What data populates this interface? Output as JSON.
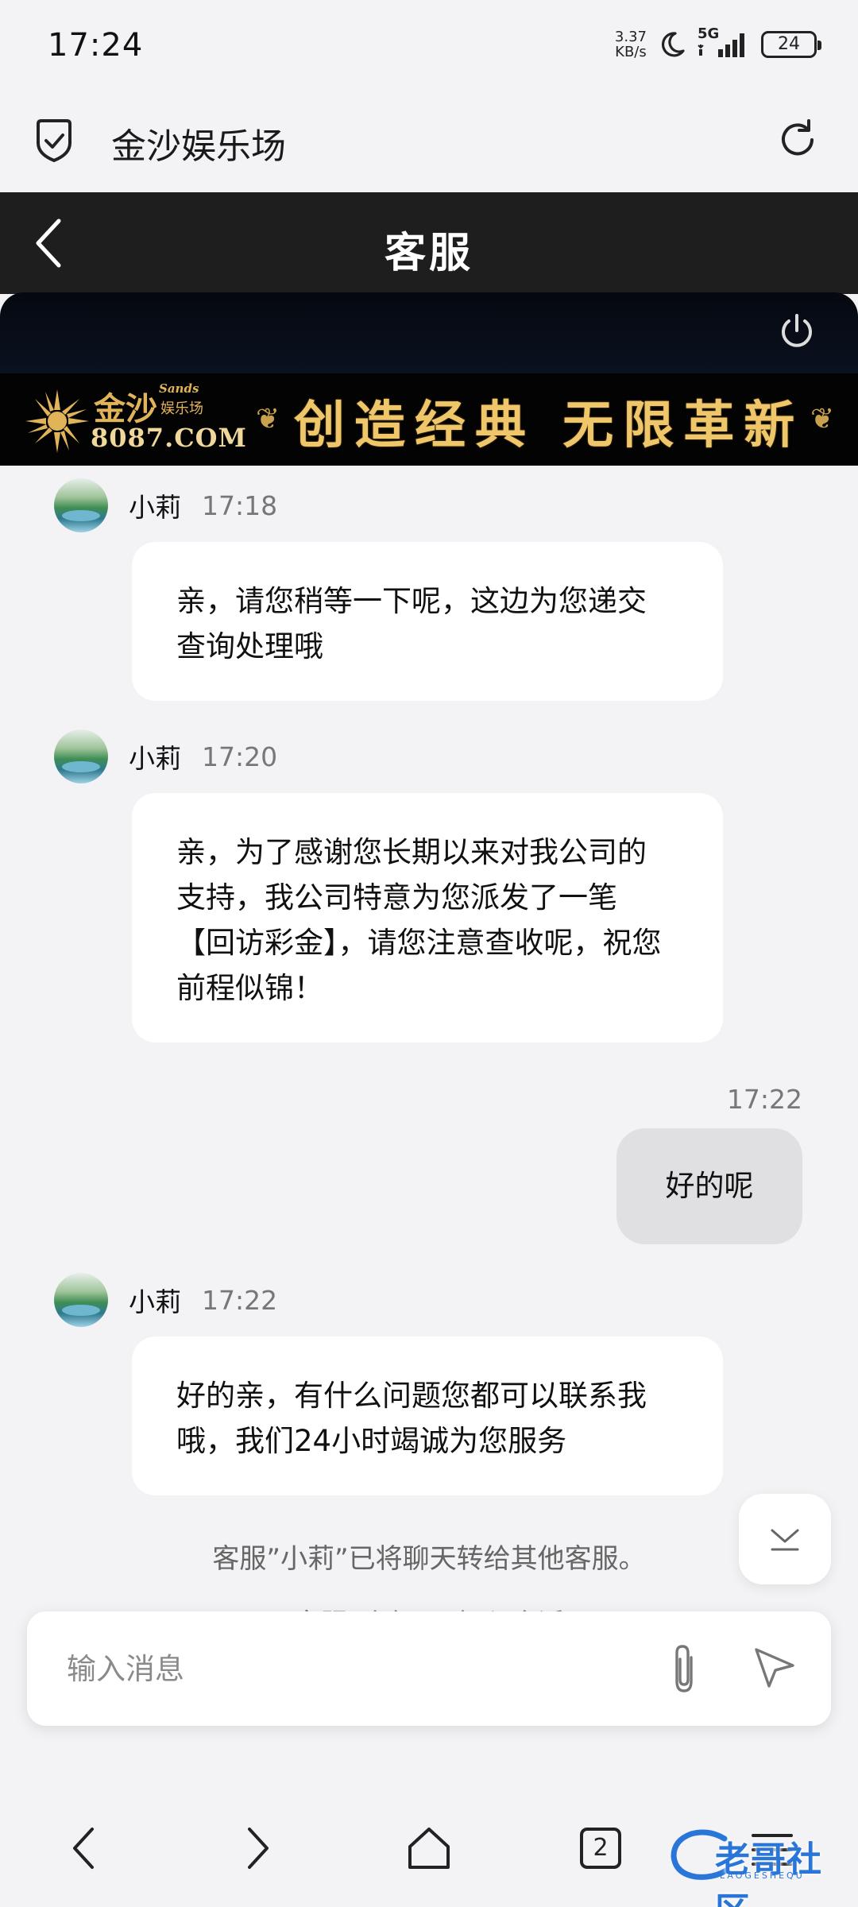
{
  "status_bar": {
    "time": "17:24",
    "net_speed_value": "3.37",
    "net_speed_unit": "KB/s",
    "network": "5G",
    "battery": "24"
  },
  "browser": {
    "site_title": "金沙娱乐场"
  },
  "chat_header": {
    "title": "客服"
  },
  "banner": {
    "brand": "金沙",
    "brand_sands": "Sands",
    "brand_sub": "娱乐场",
    "url": "8087.COM",
    "slogan": "创造经典 无限革新"
  },
  "messages": [
    {
      "sender": "小莉",
      "time": "17:18",
      "text_lines": [
        "亲，请您稍等一下呢，这边为您递交",
        "查询处理哦"
      ]
    },
    {
      "sender": "小莉",
      "time": "17:20",
      "text_lines": [
        "亲，为了感谢您长期以来对我公司的",
        "支持，我公司特意为您派发了一笔",
        "【回访彩金】，请您注意查收呢，祝您",
        "前程似锦！"
      ]
    },
    {
      "me": true,
      "time": "17:22",
      "text": "好的呢"
    },
    {
      "sender": "小莉",
      "time": "17:22",
      "text_lines": [
        "好的亲，有什么问题您都可以联系我",
        "哦，我们24小时竭诚为您服务"
      ]
    }
  ],
  "system_note": "客服”小莉”已将聊天转给其他客服。",
  "system_note_partial": "客服”小红”已加入会话",
  "input": {
    "placeholder": "输入消息"
  },
  "nav": {
    "tab_count": "2"
  },
  "watermark": {
    "text": "老哥社区",
    "sub": "LAOGESHEQU"
  },
  "colors": {
    "header_bg": "#1e1e1e",
    "banner_gold": "#f0c66a",
    "page_bg": "#f3f3f5",
    "my_bubble": "#e0e0e2"
  }
}
